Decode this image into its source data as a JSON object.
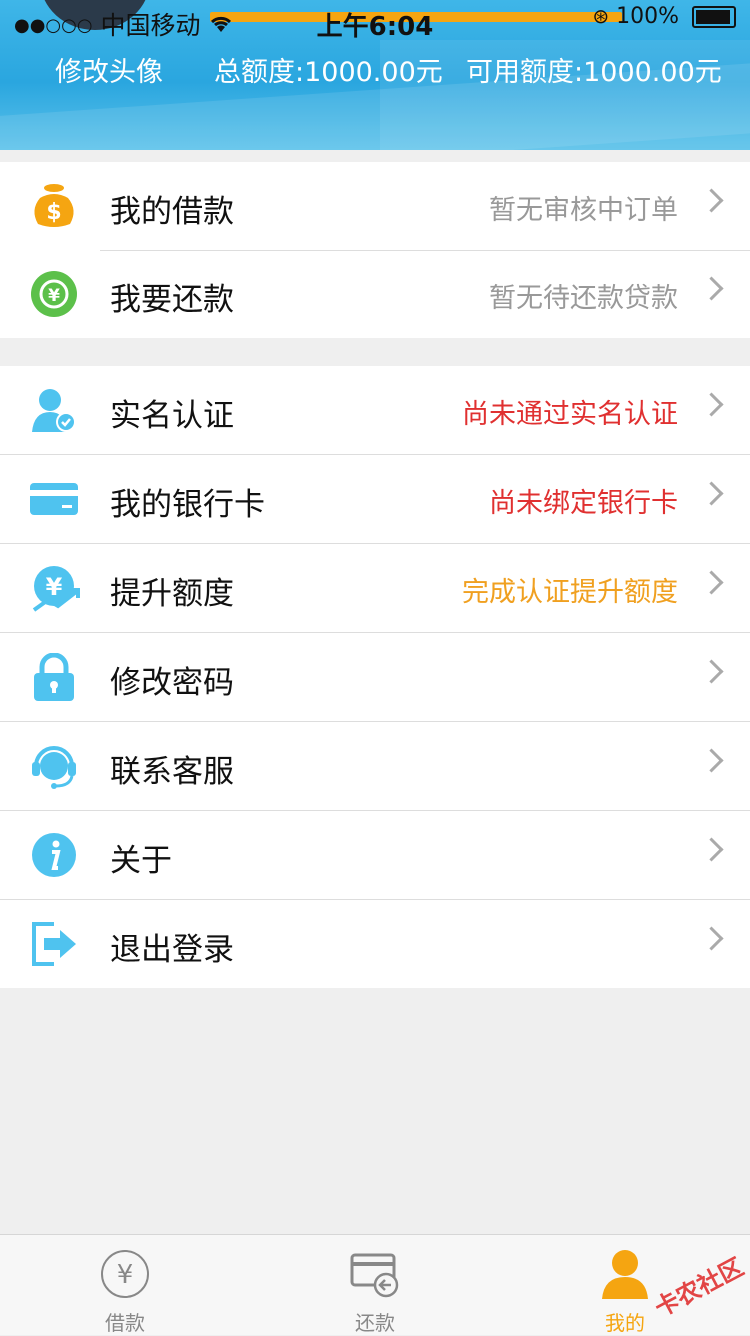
{
  "status_bar": {
    "carrier": "中国移动",
    "signal_dots": "●●○○○",
    "time": "上午6:04",
    "battery": "100%"
  },
  "header": {
    "edit_avatar": "修改头像",
    "total_quota": "总额度:1000.00元",
    "available_quota": "可用额度:1000.00元"
  },
  "loans_section": [
    {
      "label": "我的借款",
      "value": "暂无审核中订单",
      "icon": "money-bag-icon"
    },
    {
      "label": "我要还款",
      "value": "暂无待还款贷款",
      "icon": "repay-cycle-icon"
    }
  ],
  "account_section": [
    {
      "label": "实名认证",
      "value": "尚未通过实名认证",
      "value_color": "#e03030",
      "icon": "user-verified-icon"
    },
    {
      "label": "我的银行卡",
      "value": "尚未绑定银行卡",
      "value_color": "#e03030",
      "icon": "bank-card-icon"
    },
    {
      "label": "提升额度",
      "value": "完成认证提升额度",
      "value_color": "#f0a020",
      "icon": "raise-quota-icon"
    },
    {
      "label": "修改密码",
      "value": "",
      "icon": "lock-icon"
    },
    {
      "label": "联系客服",
      "value": "",
      "icon": "headset-icon"
    },
    {
      "label": "关于",
      "value": "",
      "icon": "info-icon"
    },
    {
      "label": "退出登录",
      "value": "",
      "icon": "logout-icon"
    }
  ],
  "tabbar": {
    "tabs": [
      {
        "label": "借款",
        "icon": "yen-circle-icon",
        "active": false
      },
      {
        "label": "还款",
        "icon": "repay-card-icon",
        "active": false
      },
      {
        "label": "我的",
        "icon": "person-icon",
        "active": true
      }
    ]
  },
  "watermark": "卡农社区",
  "colors": {
    "header_blue": "#2aa6df",
    "accent_orange": "#f5a511",
    "icon_blue": "#4fc3ef",
    "alert_red": "#e03030"
  }
}
